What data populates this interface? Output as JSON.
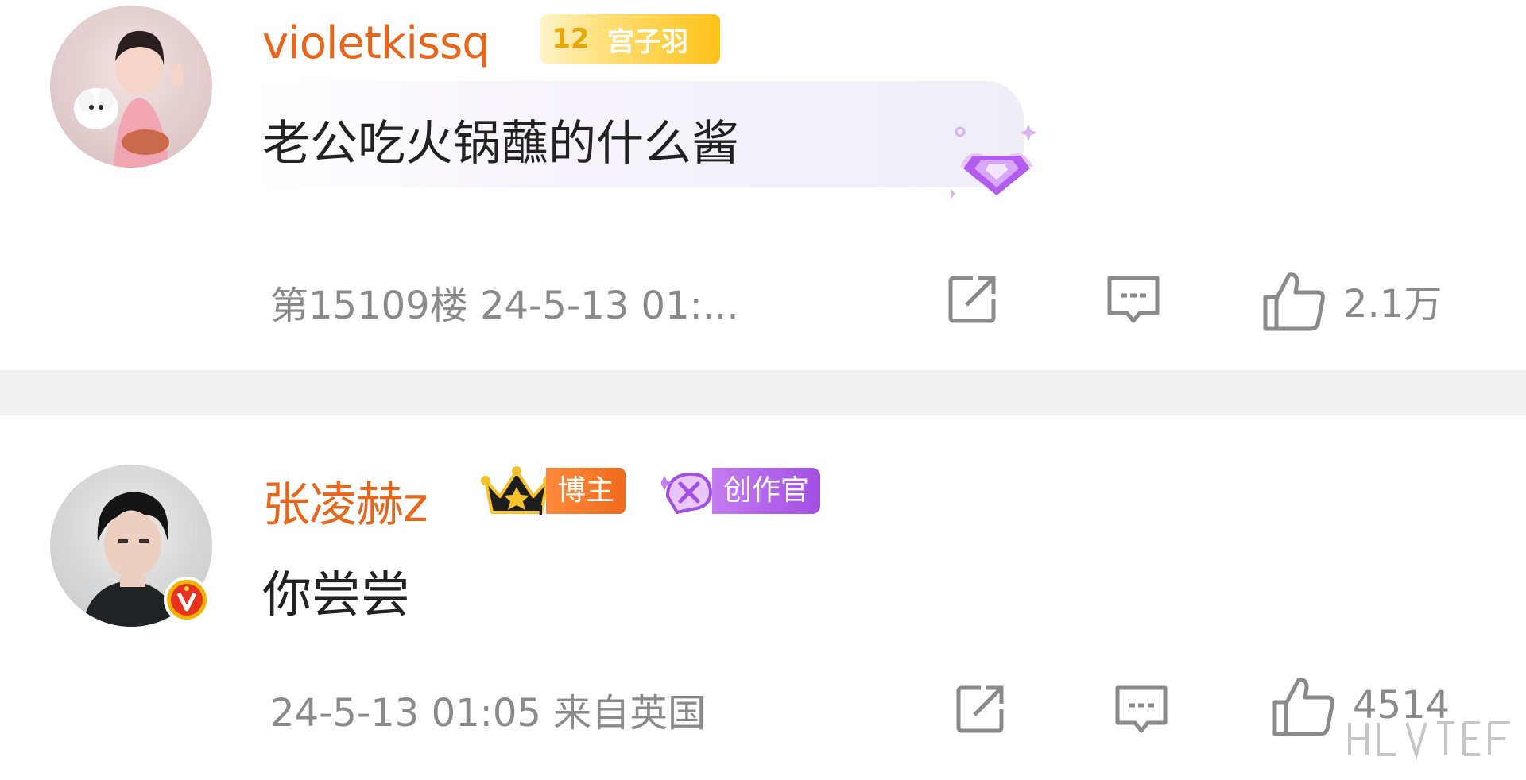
{
  "comments": [
    {
      "username": "violetkissq",
      "badge_level": "12",
      "badge_text": "宫子羽",
      "content": "老公吃火锅蘸的什么酱",
      "meta": "第15109楼 24-5-13 01:...",
      "likes": "2.1万"
    },
    {
      "username": "张凌赫z",
      "badge_blogger": "博主",
      "badge_creator": "创作官",
      "content": "你尝尝",
      "meta": "24-5-13 01:05 来自英国",
      "likes": "4514"
    }
  ],
  "icons": {
    "share": "share-icon",
    "reply": "comment-icon",
    "like": "thumbs-up-icon",
    "verified": "verified-v-icon",
    "gem": "purple-gem-icon",
    "crown": "crown-icon"
  },
  "colors": {
    "username": "#e8651c",
    "meta": "#8a8a8a",
    "level_badge": "#ffc21a",
    "blogger_badge": "#f06a1c",
    "creator_badge": "#a24fe3",
    "separator": "#f1f1f1"
  }
}
